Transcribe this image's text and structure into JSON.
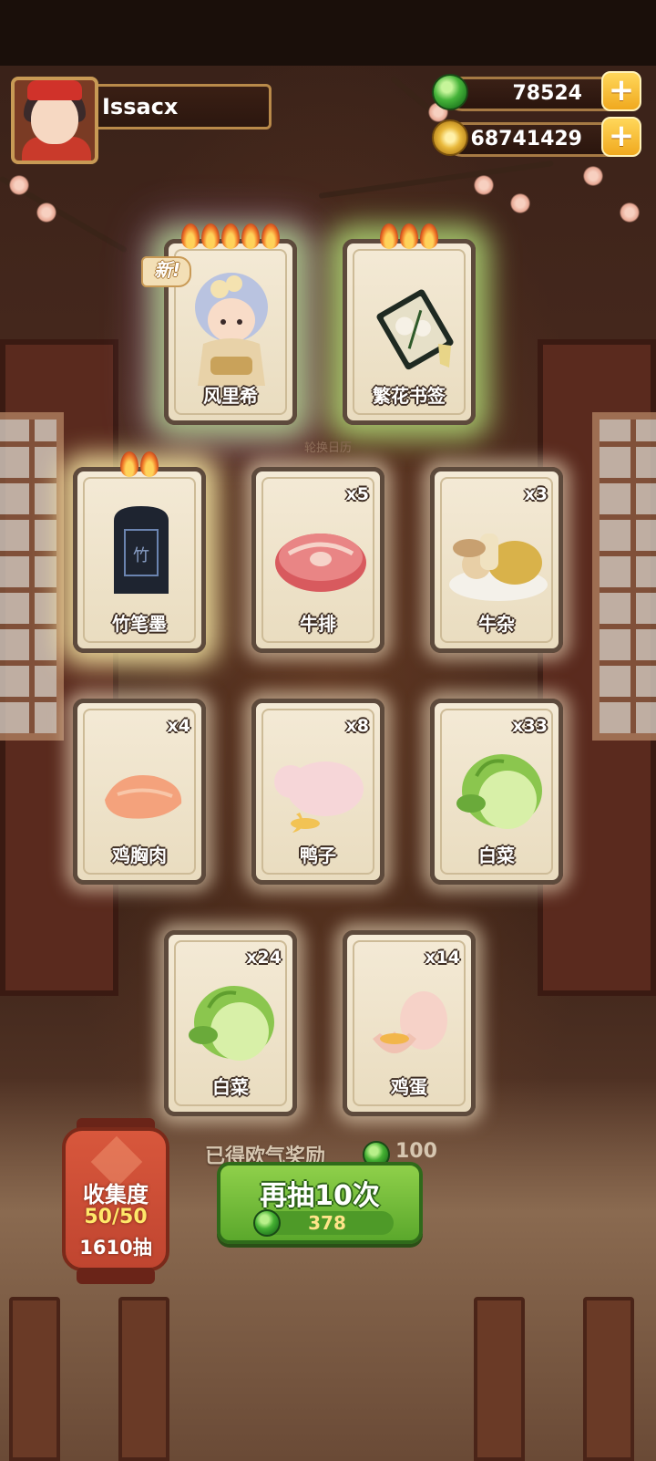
{
  "player": {
    "name": "Issacx"
  },
  "currencies": [
    {
      "name": "jade",
      "value": "78524",
      "icon": "jade-coin-icon",
      "color": "#3fa83a"
    },
    {
      "name": "copper",
      "value": "68741429",
      "icon": "copper-coin-icon",
      "color": "#e2b23e"
    }
  ],
  "plus_symbol": "+",
  "featured_cards": [
    {
      "label": "风里希",
      "flames": 5,
      "new_tag": "新!",
      "icon": "fenglixi-character-icon"
    },
    {
      "label": "繁花书签",
      "flames": 3,
      "icon": "flower-bookmark-icon"
    }
  ],
  "rotate_calendar": "轮换日历",
  "cards": [
    {
      "label": "竹笔墨",
      "count": "",
      "flames": 2,
      "icon": "ink-stick-icon"
    },
    {
      "label": "牛排",
      "count": "x5",
      "icon": "steak-icon"
    },
    {
      "label": "牛杂",
      "count": "x3",
      "icon": "beef-offal-icon"
    },
    {
      "label": "鸡胸肉",
      "count": "x4",
      "icon": "chicken-breast-icon"
    },
    {
      "label": "鸭子",
      "count": "x8",
      "icon": "duck-icon"
    },
    {
      "label": "白菜",
      "count": "x33",
      "icon": "cabbage-icon"
    },
    {
      "label": "白菜",
      "count": "x24",
      "icon": "cabbage-icon"
    },
    {
      "label": "鸡蛋",
      "count": "x14",
      "icon": "egg-icon"
    }
  ],
  "reward": {
    "text": "已得欧气奖励",
    "amount": "100",
    "icon": "jade-coin-icon"
  },
  "redraw": {
    "label": "再抽10次",
    "cost": "378",
    "icon": "jade-coin-icon",
    "color": "#6cbc36"
  },
  "collection": {
    "title": "收集度",
    "progress": "50/50",
    "draws": "1610抽"
  }
}
